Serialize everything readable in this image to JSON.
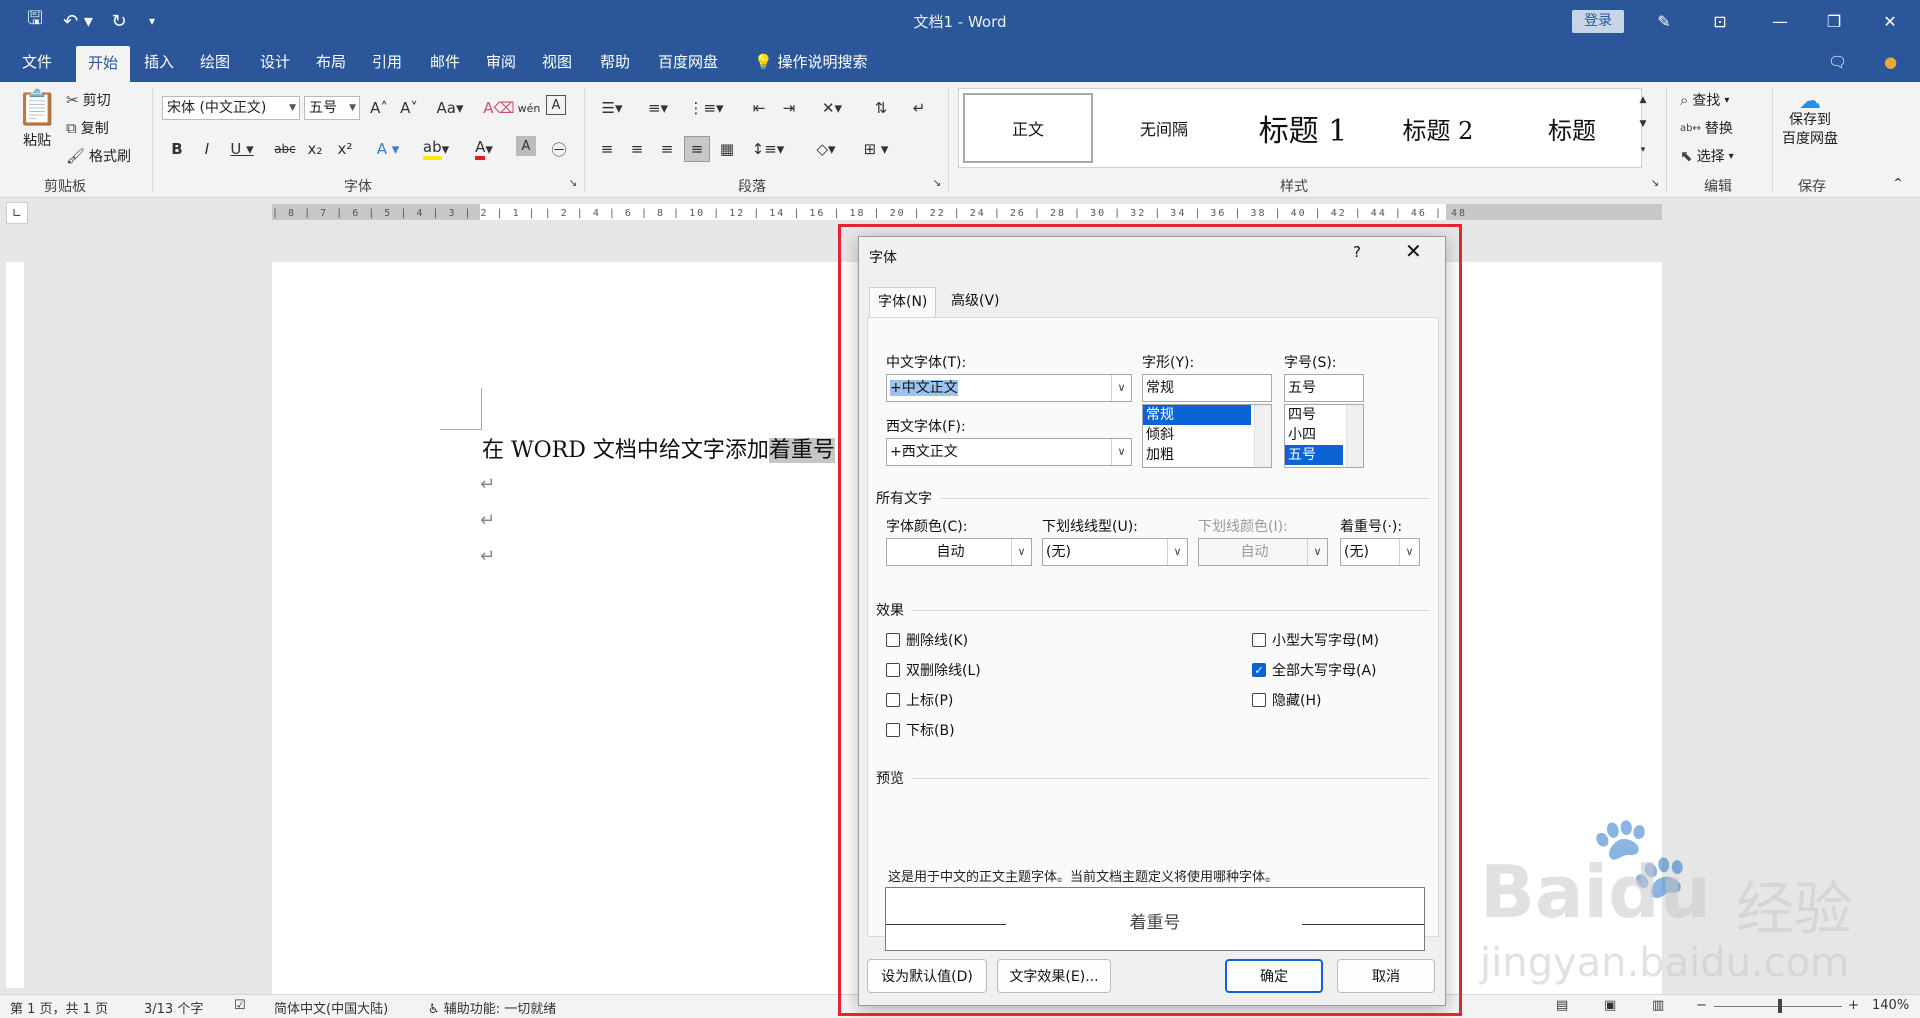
{
  "titlebar": {
    "doc_title": "文档1  -  Word",
    "login_label": "登录"
  },
  "ribbon_tabs": [
    "文件",
    "开始",
    "插入",
    "绘图",
    "设计",
    "布局",
    "引用",
    "邮件",
    "审阅",
    "视图",
    "帮助",
    "百度网盘"
  ],
  "tell_me": "操作说明搜索",
  "clipboard": {
    "paste": "粘贴",
    "cut": "剪切",
    "copy": "复制",
    "format_painter": "格式刷",
    "group_label": "剪贴板"
  },
  "font_group": {
    "font_name": "宋体 (中文正文)",
    "font_size": "五号",
    "group_label": "字体"
  },
  "paragraph_group": {
    "group_label": "段落"
  },
  "styles_group": {
    "group_label": "样式",
    "items": [
      "正文",
      "无间隔",
      "标题 1",
      "标题 2",
      "标题"
    ]
  },
  "editing_group": {
    "find": "查找",
    "replace": "替换",
    "select": "选择",
    "group_label": "编辑"
  },
  "save_group": {
    "save_line1": "保存到",
    "save_line2": "百度网盘",
    "group_label": "保存"
  },
  "ruler_text": "| 8 | 7 | 6 | 5 | 4 | 3 | 2 | 1 |  | 2 | 4 | 6 | 8 | 10 | 12 | 14 | 16 | 18 | 20 | 22 | 24 | 26 | 28 | 30 | 32 | 34 | 36 | 38 | 40 | 42 | 44 | 46 | 48",
  "document": {
    "line_before": "在 WORD 文档中给文字添加",
    "line_highlight": "着重号"
  },
  "statusbar": {
    "page": "第 1 页，共 1 页",
    "words": "3/13 个字",
    "language": "简体中文(中国大陆)",
    "accessibility": "辅助功能: 一切就绪",
    "zoom": "140%"
  },
  "dialog": {
    "title": "字体",
    "help": "?",
    "tabs": [
      "字体(N)",
      "高级(V)"
    ],
    "cn_font_label": "中文字体(T):",
    "cn_font_value": "+中文正文",
    "west_font_label": "西文字体(F):",
    "west_font_value": "+西文正文",
    "style_label": "字形(Y):",
    "style_value": "常规",
    "style_options": [
      "常规",
      "倾斜",
      "加粗"
    ],
    "size_label": "字号(S):",
    "size_value": "五号",
    "size_options": [
      "四号",
      "小四",
      "五号"
    ],
    "all_text_title": "所有文字",
    "color_label": "字体颜色(C):",
    "color_value": "自动",
    "underline_label": "下划线线型(U):",
    "underline_value": "(无)",
    "underline_color_label": "下划线颜色(I):",
    "underline_color_value": "自动",
    "emphasis_label": "着重号(·):",
    "emphasis_value": "(无)",
    "effects_title": "效果",
    "effects_left": [
      "删除线(K)",
      "双删除线(L)",
      "上标(P)",
      "下标(B)"
    ],
    "effects_right": [
      "小型大写字母(M)",
      "全部大写字母(A)",
      "隐藏(H)"
    ],
    "effects_right_checked": [
      false,
      true,
      false
    ],
    "preview_title": "预览",
    "preview_text": "着重号",
    "description": "这是用于中文的正文主题字体。当前文档主题定义将使用哪种字体。",
    "btn_default": "设为默认值(D)",
    "btn_effects": "文字效果(E)...",
    "btn_ok": "确定",
    "btn_cancel": "取消"
  },
  "watermark": {
    "brand": "Bai",
    "brand_suffix": "du",
    "brand_cn": "经验",
    "url": "jingyan.baidu.com"
  },
  "colors": {
    "word_blue": "#2b579a",
    "accent": "#0a64d6",
    "highlight_frame": "#e8232e"
  }
}
